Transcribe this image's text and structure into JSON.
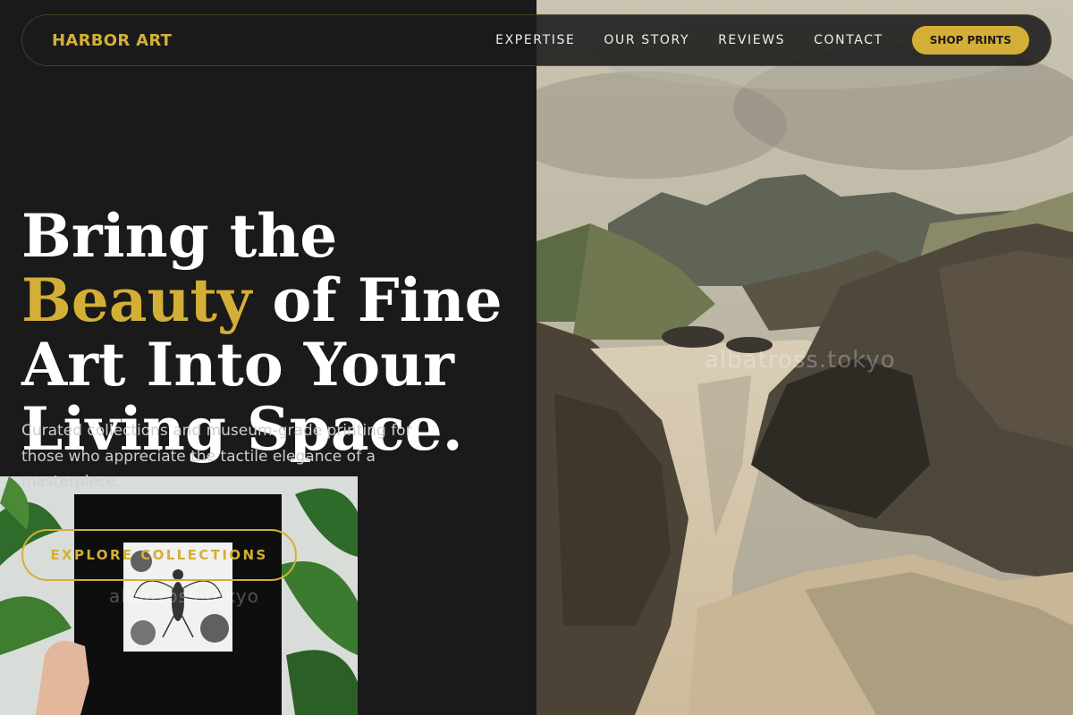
{
  "nav": {
    "brand": "HARBOR ART",
    "links": [
      "EXPERTISE",
      "OUR STORY",
      "REVIEWS",
      "CONTACT"
    ],
    "cta": "SHOP PRINTS"
  },
  "hero": {
    "title_before": "Bring the ",
    "title_highlight": "Beauty",
    "title_after": " of Fine Art Into Your Living Space.",
    "subtitle": "Curated collections and museum-grade printing for those who appreciate the tactile elegance of a masterpiece.",
    "cta": "EXPLORE COLLECTIONS"
  },
  "watermarks": {
    "painting": "albatross.tokyo",
    "photo": "albatross.tokyo"
  },
  "colors": {
    "accent": "#d4af37",
    "background": "#1a1a1a"
  }
}
